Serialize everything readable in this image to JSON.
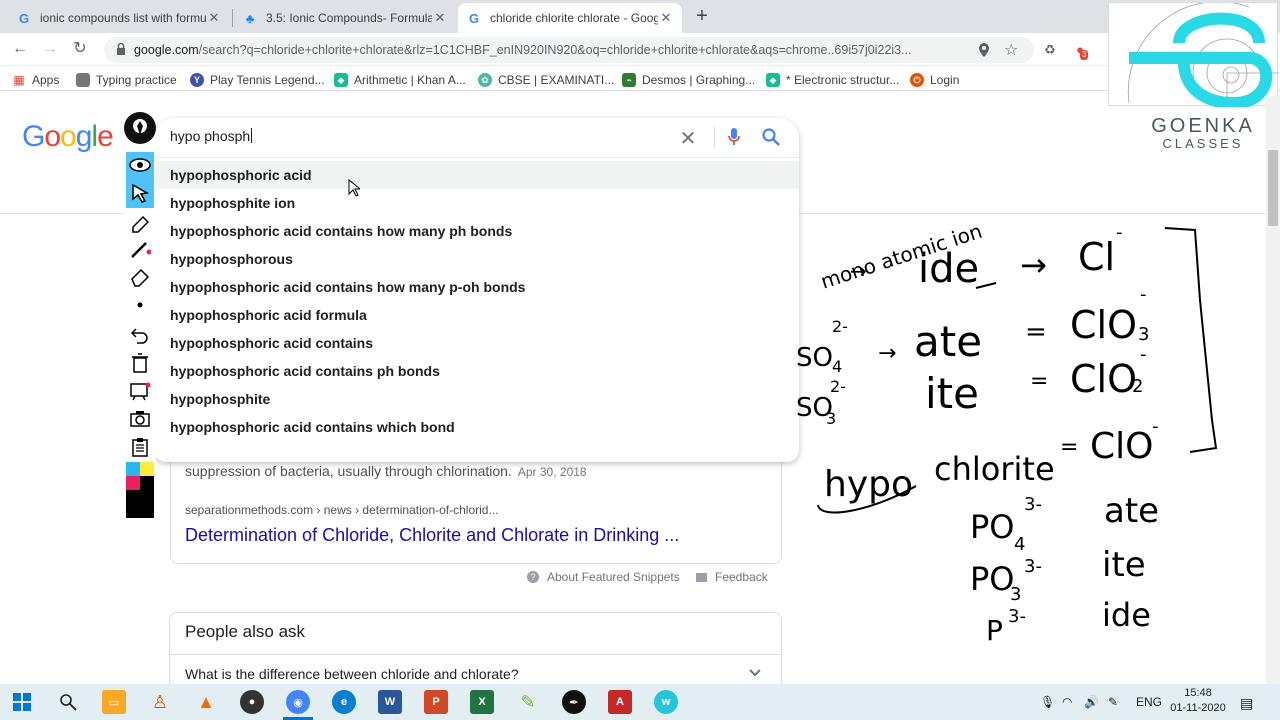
{
  "tabs": [
    {
      "title": "ionic compounds list with formul",
      "favicon": "G"
    },
    {
      "title": "3.5: Ionic Compounds- Formulas",
      "favicon": "♣"
    },
    {
      "title": "chloride chlorite chlorate - Goog",
      "favicon": "G"
    }
  ],
  "new_tab_label": "+",
  "address": {
    "host": "google.com",
    "path": "/search?q=chloride+chlorite+chlorate&rlz=1C1CHBF_enIN920IN920&oq=chloride+chlorite+chlorate&aqs=chrome..69i57j0i22i3..."
  },
  "bookmarks": [
    {
      "label": "Apps",
      "color": "#ea4335"
    },
    {
      "label": "Typing practice",
      "color": "#777777"
    },
    {
      "label": "Play Tennis Legend...",
      "color": "#3f51b5"
    },
    {
      "label": "Arithmetic | Khan A...",
      "color": "#14bf96"
    },
    {
      "label": "CBSE | EXAMINATI...",
      "color": "#4db6ac"
    },
    {
      "label": "Desmos | Graphing...",
      "color": "#2e7d32"
    },
    {
      "label": "* Electronic structur...",
      "color": "#14bf96"
    },
    {
      "label": "Login",
      "color": "#e65100"
    }
  ],
  "extension_badge": "3",
  "google_logo": [
    "G",
    "o",
    "o",
    "g",
    "l",
    "e"
  ],
  "search": {
    "query": "hypo phosph",
    "suggestions": [
      "hypophosphoric acid",
      "hypophosphite ion",
      "hypophosphoric acid contains how many ph bonds",
      "hypophosphorous",
      "hypophosphoric acid contains how many p-oh bonds",
      "hypophosphoric acid formula",
      "hypophosphoric acid contains",
      "hypophosphoric acid contains ph bonds",
      "hypophosphite",
      "hypophosphoric acid contains which bond"
    ]
  },
  "snippet": {
    "text": "suppression of bacteria, usually through chlorination.",
    "date": "Apr 30, 2018",
    "url": "separationmethods.com › news › determination-of-chlorid...",
    "link": "Determination of Chloride, Chlorite and Chlorate in Drinking ...",
    "about": "About Featured Snippets",
    "feedback": "Feedback"
  },
  "paa": {
    "title": "People also ask",
    "question": "What is the difference between chloride and chlorate?"
  },
  "brand": {
    "line1": "GOENKA",
    "line2": "CLASSES"
  },
  "handwriting": {
    "monoatomic": "mono atomic ion",
    "ide": "ide",
    "cl": "Cl",
    "so4": "SO",
    "so3": "SO",
    "ate": "ate",
    "ite": "ite",
    "clo3": "ClO",
    "clo2": "ClO",
    "hypo": "hypo",
    "chlorite": "chlorite",
    "clo": "ClO",
    "po4": "PO",
    "po3": "PO",
    "p3": "P",
    "charge2": "2-",
    "charge3": "3-",
    "minus": "-",
    "sub4": "4",
    "sub3": "3",
    "sub2": "2",
    "arrow": "→",
    "eq": "=",
    "eq2": "="
  },
  "taskbar": {
    "lang": "ENG",
    "time": "15:48",
    "date": "01-11-2020"
  },
  "colors": {
    "google_blue": "#4285f4",
    "google_red": "#ea4335",
    "google_yellow": "#fbbc05",
    "google_green": "#34a853",
    "link": "#1a0dab",
    "ink": "#000000",
    "brand_cyan": "#29d9e6"
  }
}
